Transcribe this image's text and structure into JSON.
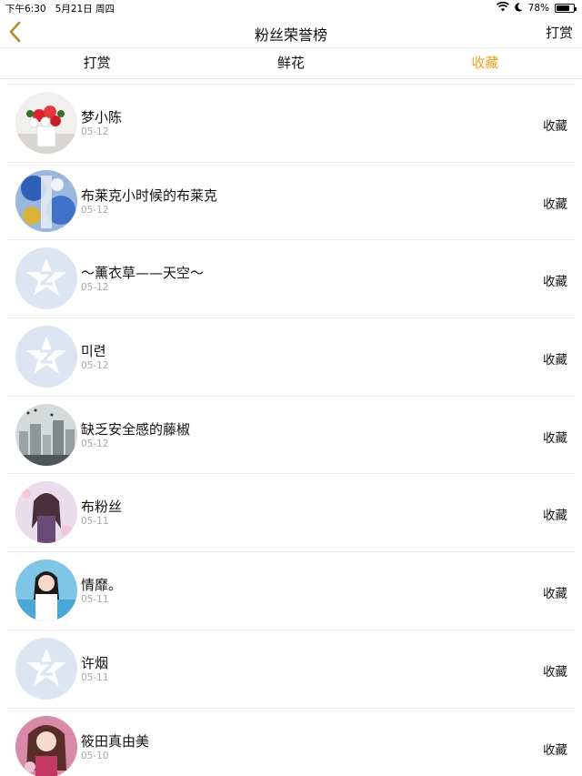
{
  "status_bar": {
    "time": "下午6:30",
    "date": "5月21日 周四",
    "battery_percent": "78%",
    "battery_level": 0.78
  },
  "nav": {
    "title": "粉丝荣誉榜",
    "right_action": "打赏"
  },
  "tabs": [
    {
      "label": "打赏",
      "active": false
    },
    {
      "label": "鲜花",
      "active": false
    },
    {
      "label": "收藏",
      "active": true
    }
  ],
  "colors": {
    "accent": "#e9a426",
    "date_gray": "#a8a8a8",
    "default_avatar_bg": "#dce6f3"
  },
  "fans": [
    {
      "name": "梦小陈",
      "date": "05-12",
      "action": "收藏",
      "avatar": "flowers-photo"
    },
    {
      "name": "布莱克小时候的布莱克",
      "date": "05-12",
      "action": "收藏",
      "avatar": "blue-glass-photo"
    },
    {
      "name": "～薰衣草——天空～",
      "date": "05-12",
      "action": "收藏",
      "avatar": "default-avatar"
    },
    {
      "name": "미련",
      "date": "05-12",
      "action": "收藏",
      "avatar": "default-avatar"
    },
    {
      "name": "缺乏安全感的藤椒",
      "date": "05-12",
      "action": "收藏",
      "avatar": "misty-city-photo"
    },
    {
      "name": "布粉丝",
      "date": "05-11",
      "action": "收藏",
      "avatar": "anime-girl-photo"
    },
    {
      "name": "情靡。",
      "date": "05-11",
      "action": "收藏",
      "avatar": "girl-beach-photo"
    },
    {
      "name": "许烟",
      "date": "05-11",
      "action": "收藏",
      "avatar": "default-avatar"
    },
    {
      "name": "筱田真由美",
      "date": "05-10",
      "action": "收藏",
      "avatar": "anime-portrait-photo"
    }
  ]
}
